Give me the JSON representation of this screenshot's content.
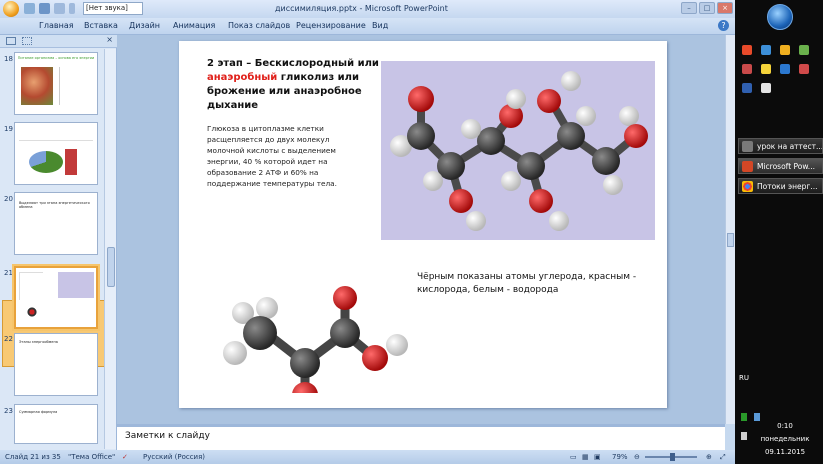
{
  "titlebar": {
    "title": "диссимиляция.pptx - Microsoft PowerPoint",
    "sound_select": "[Нет звука]"
  },
  "ribbon": {
    "tabs": [
      "Главная",
      "Вставка",
      "Дизайн",
      "Анимация",
      "Показ слайдов",
      "Рецензирование",
      "Вид"
    ]
  },
  "thumbnails": [
    {
      "num": "18",
      "title": "Питание организма – основа его энергии"
    },
    {
      "num": "19",
      "title": ""
    },
    {
      "num": "20",
      "title": "Выделяют три этапа энергетического обмена"
    },
    {
      "num": "21",
      "title": ""
    },
    {
      "num": "22",
      "title": "Этапы энергообмена"
    },
    {
      "num": "23",
      "title": "Суммарная формула"
    }
  ],
  "slide": {
    "heading_prefix": "2 этап – Бескислородный или ",
    "heading_red": "анаэробный",
    "heading_suffix": " гликолиз или брожение или анаэробное дыхание",
    "body": "Глюкоза в цитоплазме клетки расщепляется до двух молекул молочной кислоты с выделением энергии, 40 % которой идет на образование 2 АТФ и 60% на поддержание температуры тела.",
    "caption": "Чёрным показаны атомы углерода, красным - кислорода, белым - водорода"
  },
  "notes": {
    "placeholder": "Заметки к слайду"
  },
  "status": {
    "slide": "Слайд 21 из 35",
    "theme": "\"Тема Office\"",
    "language": "Русский (Россия)",
    "zoom": "79%"
  },
  "taskbar": {
    "items": [
      "урок на аттест...",
      "Microsoft Pow...",
      "Потоки энерг..."
    ],
    "lang": "RU",
    "time": "0:10",
    "day": "понедельник",
    "date": "09.11.2015"
  },
  "colors": {
    "accent": "#e8a23b",
    "carbon": "#3a3a3a",
    "oxygen": "#d8141a",
    "hydrogen": "#f2f2f2"
  }
}
